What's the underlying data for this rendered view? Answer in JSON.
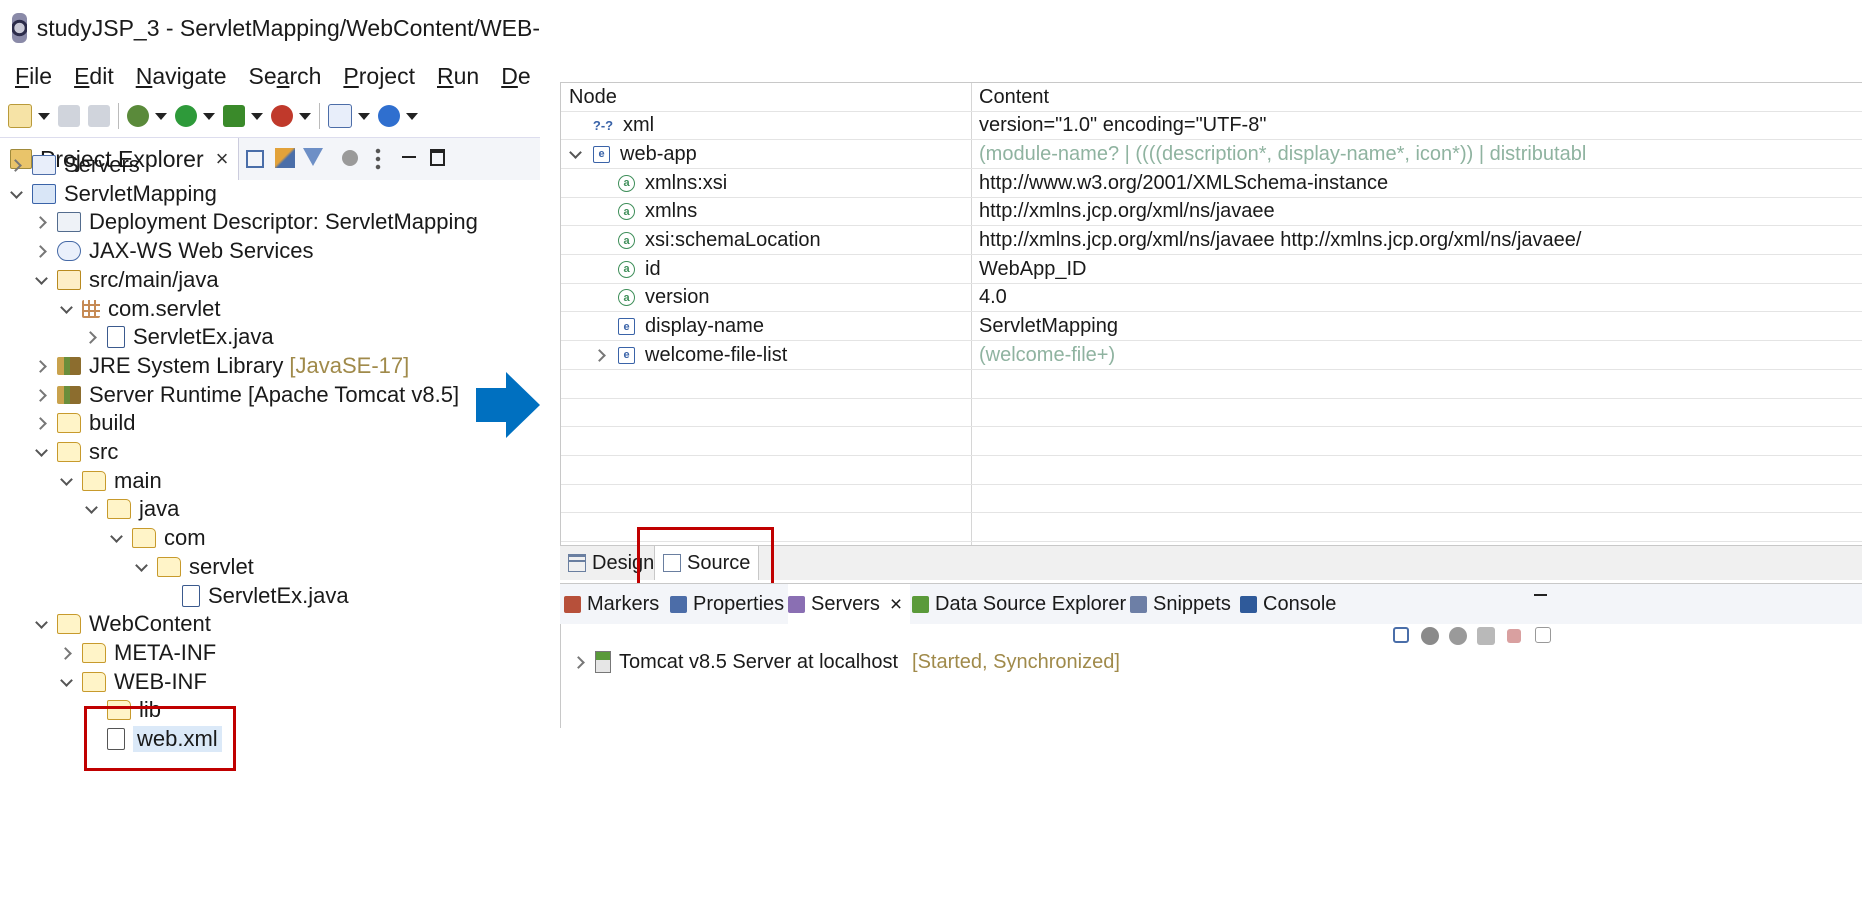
{
  "window": {
    "title": "studyJSP_3 - ServletMapping/WebContent/WEB-"
  },
  "menu": [
    {
      "pre": "",
      "u": "F",
      "post": "ile"
    },
    {
      "pre": "",
      "u": "E",
      "post": "dit"
    },
    {
      "pre": "",
      "u": "N",
      "post": "avigate"
    },
    {
      "pre": "Se",
      "u": "a",
      "post": "rch"
    },
    {
      "pre": "",
      "u": "P",
      "post": "roject"
    },
    {
      "pre": "",
      "u": "R",
      "post": "un"
    },
    {
      "pre": "",
      "u": "D",
      "post": "e"
    }
  ],
  "explorer": {
    "tab_label": "Project Explorer",
    "close_glyph": "×",
    "tree": [
      {
        "label": "Servers",
        "extra": "",
        "depth": 0,
        "twisty": "col",
        "icon": "server"
      },
      {
        "label": "ServletMapping",
        "extra": "",
        "depth": 0,
        "twisty": "exp",
        "icon": "project"
      },
      {
        "label": "Deployment Descriptor: ServletMapping",
        "extra": "",
        "depth": 1,
        "twisty": "col",
        "icon": "desc"
      },
      {
        "label": "JAX-WS Web Services",
        "extra": "",
        "depth": 1,
        "twisty": "col",
        "icon": "ws"
      },
      {
        "label": "src/main/java",
        "extra": "",
        "depth": 1,
        "twisty": "exp",
        "icon": "srcf"
      },
      {
        "label": "com.servlet",
        "extra": "",
        "depth": 2,
        "twisty": "exp",
        "icon": "pkg"
      },
      {
        "label": "ServletEx.java",
        "extra": "",
        "depth": 3,
        "twisty": "col",
        "icon": "java"
      },
      {
        "label": "JRE System Library",
        "extra": "[JavaSE-17]",
        "depth": 1,
        "twisty": "col",
        "icon": "lib"
      },
      {
        "label": "Server Runtime [Apache Tomcat v8.5]",
        "extra": "",
        "depth": 1,
        "twisty": "col",
        "icon": "lib"
      },
      {
        "label": "build",
        "extra": "",
        "depth": 1,
        "twisty": "col",
        "icon": "folder"
      },
      {
        "label": "src",
        "extra": "",
        "depth": 1,
        "twisty": "exp",
        "icon": "folder"
      },
      {
        "label": "main",
        "extra": "",
        "depth": 2,
        "twisty": "exp",
        "icon": "folder"
      },
      {
        "label": "java",
        "extra": "",
        "depth": 3,
        "twisty": "exp",
        "icon": "folder"
      },
      {
        "label": "com",
        "extra": "",
        "depth": 4,
        "twisty": "exp",
        "icon": "folder"
      },
      {
        "label": "servlet",
        "extra": "",
        "depth": 5,
        "twisty": "exp",
        "icon": "folder"
      },
      {
        "label": "ServletEx.java",
        "extra": "",
        "depth": 6,
        "twisty": "none",
        "icon": "java"
      },
      {
        "label": "WebContent",
        "extra": "",
        "depth": 1,
        "twisty": "exp",
        "icon": "folder"
      },
      {
        "label": "META-INF",
        "extra": "",
        "depth": 2,
        "twisty": "col",
        "icon": "folder"
      },
      {
        "label": "WEB-INF",
        "extra": "",
        "depth": 2,
        "twisty": "exp",
        "icon": "folder"
      },
      {
        "label": "lib",
        "extra": "",
        "depth": 3,
        "twisty": "none",
        "icon": "folder"
      },
      {
        "label": "web.xml",
        "extra": "",
        "depth": 3,
        "twisty": "none",
        "icon": "xml",
        "selected": true
      }
    ]
  },
  "editor": {
    "headers": {
      "node": "Node",
      "content": "Content"
    },
    "rows": [
      {
        "node": "xml",
        "content": "version=\"1.0\" encoding=\"UTF-8\"",
        "kind": "pi",
        "depth": 0,
        "twisty": "none",
        "grey": false
      },
      {
        "node": "web-app",
        "content": "(module-name? | ((((description*, display-name*, icon*)) | distributabl",
        "kind": "elem",
        "depth": 0,
        "twisty": "exp",
        "grey": true
      },
      {
        "node": "xmlns:xsi",
        "content": "http://www.w3.org/2001/XMLSchema-instance",
        "kind": "attr",
        "depth": 1,
        "twisty": "none",
        "grey": false
      },
      {
        "node": "xmlns",
        "content": "http://xmlns.jcp.org/xml/ns/javaee",
        "kind": "attr",
        "depth": 1,
        "twisty": "none",
        "grey": false
      },
      {
        "node": "xsi:schemaLocation",
        "content": "http://xmlns.jcp.org/xml/ns/javaee http://xmlns.jcp.org/xml/ns/javaee/",
        "kind": "attr",
        "depth": 1,
        "twisty": "none",
        "grey": false
      },
      {
        "node": "id",
        "content": "WebApp_ID",
        "kind": "attr",
        "depth": 1,
        "twisty": "none",
        "grey": false
      },
      {
        "node": "version",
        "content": "4.0",
        "kind": "attr",
        "depth": 1,
        "twisty": "none",
        "grey": false
      },
      {
        "node": "display-name",
        "content": "ServletMapping",
        "kind": "elem",
        "depth": 1,
        "twisty": "none",
        "grey": false
      },
      {
        "node": "welcome-file-list",
        "content": "(welcome-file+)",
        "kind": "elem",
        "depth": 1,
        "twisty": "col",
        "grey": true
      }
    ],
    "empty_rows": 6
  },
  "editor_tabs": {
    "design": "Design",
    "source": "Source"
  },
  "bottom_tabs": [
    {
      "label": "Markers",
      "color": "#b7503a"
    },
    {
      "label": "Properties",
      "color": "#4c6da8"
    },
    {
      "label": "Servers",
      "color": "#8a6fb3",
      "active": true
    },
    {
      "label": "Data Source Explorer",
      "color": "#5a9a3a"
    },
    {
      "label": "Snippets",
      "color": "#6d7fa6"
    },
    {
      "label": "Console",
      "color": "#2f5a9a"
    }
  ],
  "servers_close_glyph": "×",
  "servers": [
    {
      "name": "Tomcat v8.5 Server at localhost",
      "status": "[Started, Synchronized]"
    }
  ],
  "colors": {
    "arrow": "#0070c0",
    "highlight": "#c00000",
    "selection": "#dbe9f8"
  }
}
